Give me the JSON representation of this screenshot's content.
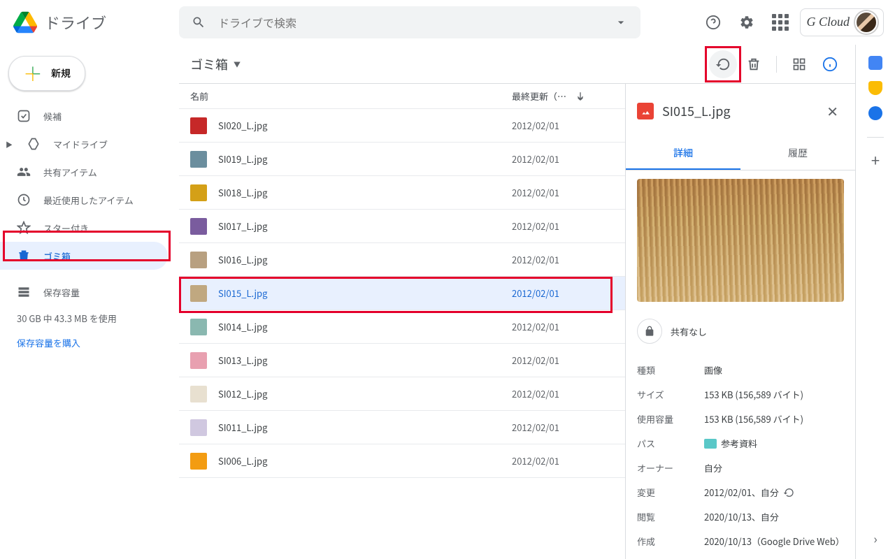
{
  "header": {
    "app_name": "ドライブ",
    "search_placeholder": "ドライブで検索",
    "account_name": "G Cloud"
  },
  "sidebar": {
    "new_btn": "新規",
    "items": [
      {
        "label": "候補"
      },
      {
        "label": "マイドライブ"
      },
      {
        "label": "共有アイテム"
      },
      {
        "label": "最近使用したアイテム"
      },
      {
        "label": "スター付き"
      },
      {
        "label": "ゴミ箱"
      },
      {
        "label": "保存容量"
      }
    ],
    "storage_text": "30 GB 中 43.3 MB を使用",
    "storage_link": "保存容量を購入"
  },
  "breadcrumb": "ゴミ箱",
  "columns": {
    "name": "名前",
    "modified": "最終更新（…"
  },
  "files": [
    {
      "name": "SI020_L.jpg",
      "date": "2012/02/01",
      "color": "#c62828"
    },
    {
      "name": "SI019_L.jpg",
      "date": "2012/02/01",
      "color": "#6b8e9e"
    },
    {
      "name": "SI018_L.jpg",
      "date": "2012/02/01",
      "color": "#d4a017"
    },
    {
      "name": "SI017_L.jpg",
      "date": "2012/02/01",
      "color": "#7a5c9e"
    },
    {
      "name": "SI016_L.jpg",
      "date": "2012/02/01",
      "color": "#b8a080"
    },
    {
      "name": "SI015_L.jpg",
      "date": "2012/02/01",
      "color": "#c0a880",
      "selected": true
    },
    {
      "name": "SI014_L.jpg",
      "date": "2012/02/01",
      "color": "#8ab8b0"
    },
    {
      "name": "SI013_L.jpg",
      "date": "2012/02/01",
      "color": "#e8a0b0"
    },
    {
      "name": "SI012_L.jpg",
      "date": "2012/02/01",
      "color": "#e8e0d0"
    },
    {
      "name": "SI011_L.jpg",
      "date": "2012/02/01",
      "color": "#d0c8e0"
    },
    {
      "name": "SI006_L.jpg",
      "date": "2012/02/01",
      "color": "#f39c12"
    }
  ],
  "details": {
    "title": "SI015_L.jpg",
    "tabs": {
      "detail": "詳細",
      "history": "履歴"
    },
    "share": "共有なし",
    "meta": [
      {
        "label": "種類",
        "value": "画像"
      },
      {
        "label": "サイズ",
        "value": "153 KB (156,589 バイト)"
      },
      {
        "label": "使用容量",
        "value": "153 KB (156,589 バイト)"
      },
      {
        "label": "パス",
        "value": "参考資料",
        "folder": true
      },
      {
        "label": "オーナー",
        "value": "自分"
      },
      {
        "label": "変更",
        "value": "2012/02/01、自分",
        "history": true
      },
      {
        "label": "閲覧",
        "value": "2020/10/13、自分"
      },
      {
        "label": "作成",
        "value": "2020/10/13（Google Drive Web）"
      }
    ]
  }
}
